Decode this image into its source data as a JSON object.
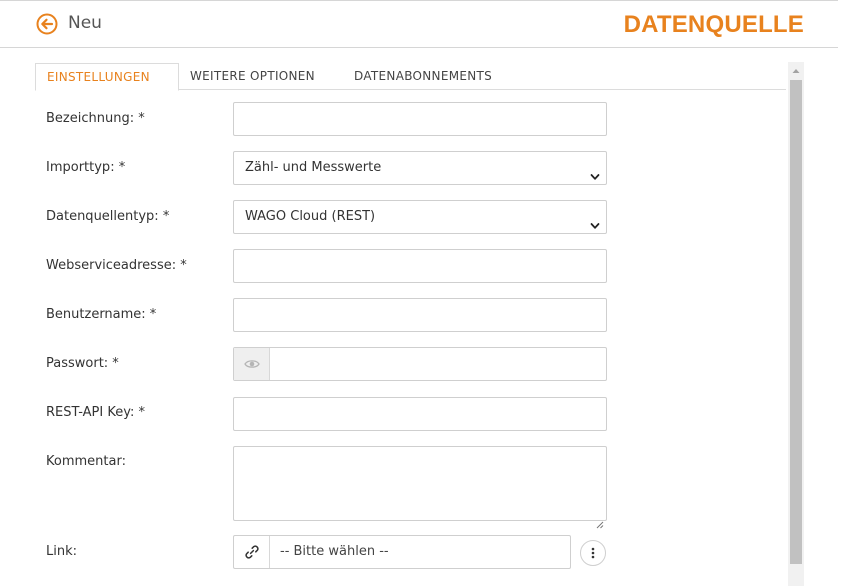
{
  "header": {
    "title": "Neu",
    "page_heading": "DATENQUELLE",
    "accent": "#e8821e"
  },
  "tabs": [
    {
      "label": "EINSTELLUNGEN",
      "active": true
    },
    {
      "label": "WEITERE OPTIONEN",
      "active": false
    },
    {
      "label": "DATENABONNEMENTS",
      "active": false
    }
  ],
  "form": {
    "bezeichnung": {
      "label": "Bezeichnung: *",
      "value": ""
    },
    "importtyp": {
      "label": "Importtyp: *",
      "value": "Zähl- und Messwerte"
    },
    "datenquellentyp": {
      "label": "Datenquellentyp: *",
      "value": "WAGO Cloud (REST)"
    },
    "webserviceadresse": {
      "label": "Webserviceadresse: *",
      "value": ""
    },
    "benutzername": {
      "label": "Benutzername: *",
      "value": ""
    },
    "passwort": {
      "label": "Passwort: *",
      "value": "",
      "icon": "eye-icon"
    },
    "rest_api_key": {
      "label": "REST-API Key: *",
      "value": ""
    },
    "kommentar": {
      "label": "Kommentar:",
      "value": ""
    },
    "link": {
      "label": "Link:",
      "value": "-- Bitte wählen --",
      "icon": "link-icon",
      "more_icon": "more-vertical-icon"
    }
  }
}
